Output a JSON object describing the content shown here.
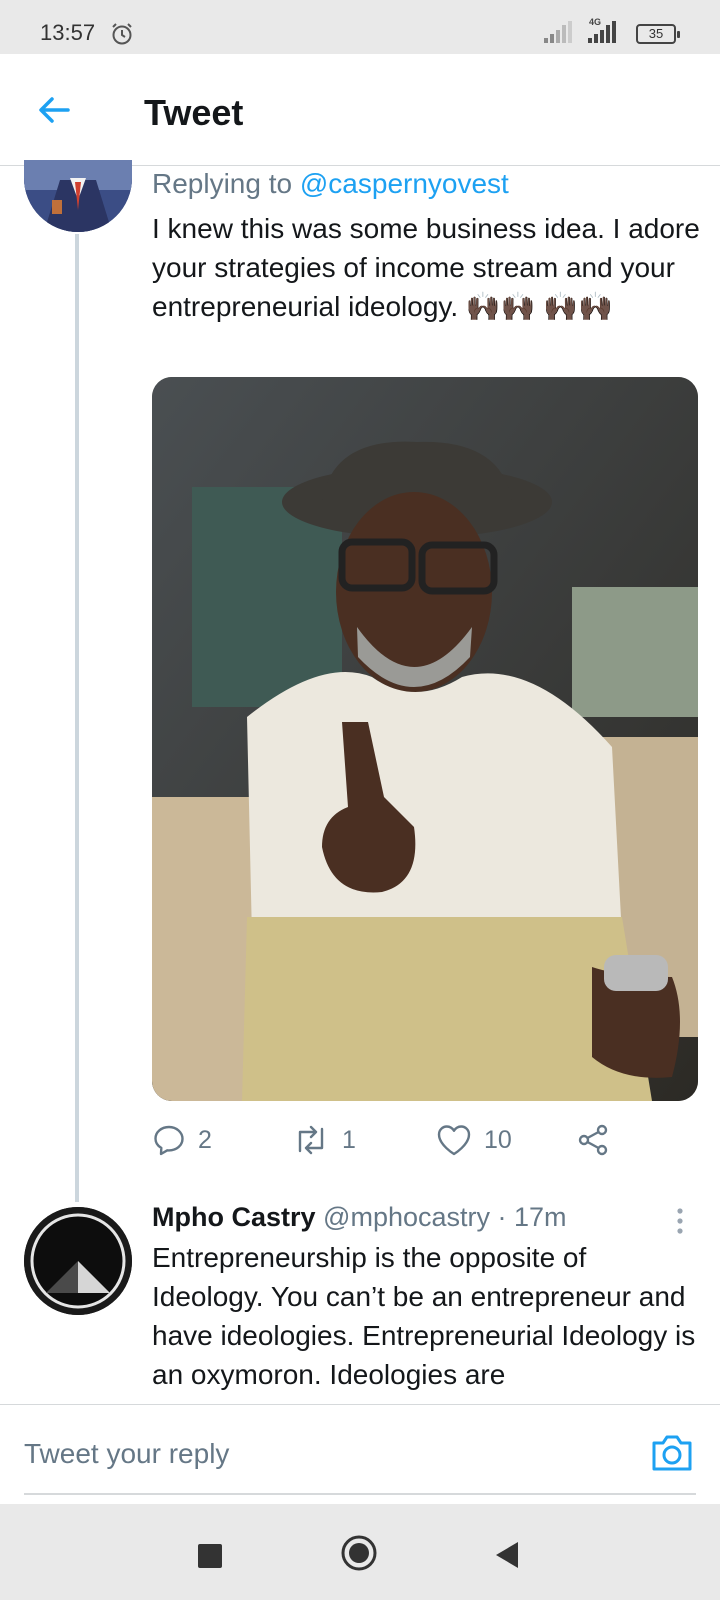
{
  "status_bar": {
    "time": "13:57",
    "network": "4G",
    "battery": "35",
    "icons": [
      "alarm-icon",
      "signal-icon",
      "4g-signal-icon",
      "battery-icon"
    ]
  },
  "header": {
    "back_icon": "arrow-left-icon",
    "title": "Tweet"
  },
  "tweet1": {
    "replying_prefix": "Replying to ",
    "replying_handle": "@caspernyovest",
    "text": "I knew this was some business idea. I adore your strategies of income stream and your entrepreneurial ideology. 🙌🏿🙌🏿 🙌🏿🙌🏿",
    "media_icon": "video-thumbnail",
    "actions": {
      "reply_count": "2",
      "retweet_count": "1",
      "like_count": "10"
    }
  },
  "tweet2": {
    "name": "Mpho Castry",
    "handle": "@mphocastry",
    "separator": " · ",
    "time": "17m",
    "text": "Entrepreneurship is the opposite of Ideology. You can’t be an entrepreneur and have ideologies. Entrepreneurial Ideology is an oxymoron. Ideologies are"
  },
  "reply_bar": {
    "placeholder": "Tweet your reply",
    "camera_icon": "camera-icon"
  },
  "nav_bar": {
    "icons": [
      "recents-square-icon",
      "home-circle-icon",
      "back-triangle-icon"
    ]
  },
  "colors": {
    "accent": "#1da1f2",
    "secondary_text": "#657786",
    "divider": "#d6d9db",
    "thread_line": "#ccd6dd"
  }
}
